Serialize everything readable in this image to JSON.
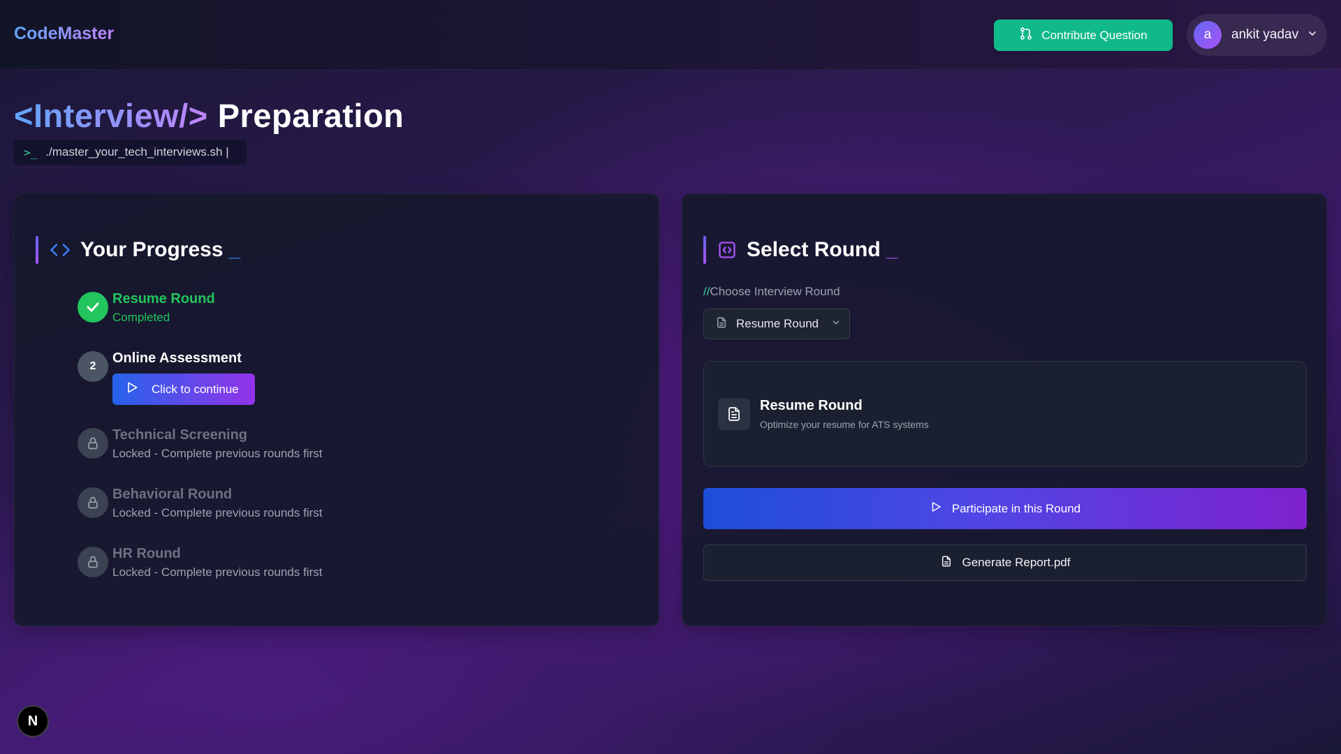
{
  "header": {
    "brand": "CodeMaster",
    "contribute_label": "Contribute Question",
    "user": {
      "initial": "a",
      "name": "ankit yadav"
    }
  },
  "hero": {
    "title_tag": "<Interview/>",
    "title_word": "Preparation",
    "command": "./master_your_tech_interviews.sh |",
    "prompt": ">_"
  },
  "progress": {
    "title": "Your Progress",
    "cursor": "_",
    "steps": [
      {
        "title": "Resume Round",
        "status": "Completed",
        "state": "done"
      },
      {
        "title": "Online Assessment",
        "number": "2",
        "action": "Click to continue",
        "state": "current"
      },
      {
        "title": "Technical Screening",
        "status": "Locked - Complete previous rounds first",
        "state": "locked"
      },
      {
        "title": "Behavioral Round",
        "status": "Locked - Complete previous rounds first",
        "state": "locked"
      },
      {
        "title": "HR Round",
        "status": "Locked - Complete previous rounds first",
        "state": "locked"
      }
    ]
  },
  "select_round": {
    "title": "Select Round",
    "cursor": "_",
    "label_prefix": "//",
    "label": "Choose Interview Round",
    "selected": "Resume Round",
    "info": {
      "title": "Resume Round",
      "description": "Optimize your resume for ATS systems"
    },
    "participate_label": "Participate in this Round",
    "report_label": "Generate Report.pdf"
  },
  "dev_badge": "N",
  "colors": {
    "accent_green": "#10b989",
    "success": "#22c55e",
    "accent_blue": "#3b82f6",
    "accent_purple": "#a855f7"
  }
}
